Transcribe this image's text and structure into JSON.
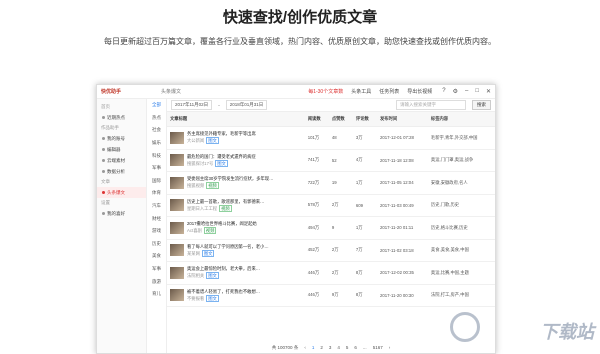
{
  "header": {
    "title": "快速查找/创作优质文章",
    "subtitle": "每日更新超过百万篇文章，覆盖各行业及垂直领域，热门内容、优质原创文章，助您快速查找或创作优质内容。"
  },
  "window": {
    "app_name": "快优助手",
    "app_search": "头条爆文",
    "links": [
      "每1-30个文章数",
      "头条工具",
      "任务列表",
      "导出长视频"
    ],
    "icons": [
      "help-icon",
      "settings-icon",
      "minimize-icon",
      "maximize-icon",
      "close-icon"
    ]
  },
  "sidebar": {
    "groups": [
      {
        "label": "首页",
        "items": [
          {
            "label": "近期热点"
          }
        ]
      },
      {
        "label": "作品助手",
        "items": [
          {
            "label": "我的账号"
          },
          {
            "label": "编辑器"
          },
          {
            "label": "云端素材"
          },
          {
            "label": "数据分析"
          }
        ]
      },
      {
        "label": "文章",
        "items": [
          {
            "label": "头条爆文",
            "active": true
          }
        ]
      },
      {
        "label": "设置",
        "items": [
          {
            "label": "我的喜好"
          }
        ]
      }
    ]
  },
  "categories": [
    "全部",
    "热点",
    "社会",
    "娱乐",
    "科技",
    "军事",
    "国际",
    "体育",
    "汽车",
    "财经",
    "游戏",
    "历史",
    "美食",
    "军事",
    "旅游",
    "育儿"
  ],
  "filter": {
    "date_from": "2017年11月02日",
    "date_to": "2018年01月31日",
    "search_placeholder": "请输入搜索关键字",
    "search_button": "搜索"
  },
  "table": {
    "columns": [
      "文章标题",
      "阅读数",
      "点赞数",
      "评论数",
      "发布时间",
      "标签内容"
    ],
    "rows": [
      {
        "title": "务主席接见外籍专家，毛新宇等出席",
        "meta": "大公新闻",
        "tag": "图文",
        "reads": "101万",
        "likes": "48",
        "comments": "3万",
        "date": "2017-12-01 07:28",
        "label": "毛新宇,青年,外交部,中国"
      },
      {
        "title": "最危险的国门：遭受老式遗弃的病症",
        "meta": "搜狐探讨17号",
        "tag": "图文",
        "reads": "741万",
        "likes": "52",
        "comments": "4万",
        "date": "2017-11-18 12:08",
        "label": "奥运,门门罩,奥运,战争"
      },
      {
        "title": "受委屈主席30岁学院发生流行症状，多年现…",
        "meta": "搜狐视频",
        "tag": "视频",
        "reads": "722万",
        "likes": "19",
        "comments": "1万",
        "date": "2017-11-05 12:04",
        "label": "安徽,安徽政府,名人"
      },
      {
        "title": "历史上最一首歌，歌谣那里，有郭德来…",
        "meta": "星期日入工工程",
        "tag": "视频",
        "reads": "578万",
        "likes": "2万",
        "comments": "609",
        "date": "2017-11-03 00:49",
        "label": "历史,门歌,历史"
      },
      {
        "title": "2017撒哈拉世界格斗比赛，闻足起始",
        "meta": "Act喜剧",
        "tag": "视频",
        "reads": "494万",
        "likes": "9",
        "comments": "1万",
        "date": "2017-11-20 01:11",
        "label": "历史,格斗比赛,历史"
      },
      {
        "title": "看了每人就可以了学问原因第一名，老小…",
        "meta": "某某网",
        "tag": "图文",
        "reads": "452万",
        "likes": "2万",
        "comments": "7万",
        "date": "2017-11-02 03:18",
        "label": "美食,美食,美食,中国"
      },
      {
        "title": "奥运会上最惊险时刻，老大拳，后来…",
        "meta": "法院相关",
        "tag": "图文",
        "reads": "446万",
        "likes": "2万",
        "comments": "8万",
        "date": "2017-12-02 00:35",
        "label": "奥运,比赛,中国,主题"
      },
      {
        "title": "被不着谱人轻易了，打死我也不敢想…",
        "meta": "不要报看",
        "tag": "图文",
        "reads": "446万",
        "likes": "9万",
        "comments": "8万",
        "date": "2017-11-20 00:30",
        "label": "法院,打工,房产,中国"
      }
    ]
  },
  "pager": {
    "total": "共 100700 条",
    "pages": [
      "1",
      "2",
      "3",
      "4",
      "5",
      "6",
      "...",
      "5167"
    ],
    "current": "1"
  },
  "watermark": "下载站"
}
